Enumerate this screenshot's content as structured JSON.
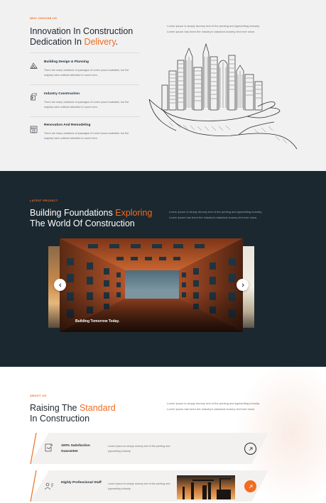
{
  "why": {
    "eyebrow": "WHY CHOOSE US",
    "title_line1": "Innovation In Construction",
    "title_line2_pre": "Dedication In ",
    "title_line2_accent": "Delivery",
    "title_line2_post": ".",
    "intro": "Lorem Ipsum is simply dummy text of the printing and typesetting industry. Lorem Ipsum has been the industry's standard dummy text ever since.",
    "features": [
      {
        "icon": "blueprint-icon",
        "title": "Building Design & Planning",
        "desc": "There are many variations of passages of Lorem Ipsum available, but the majority have suffered alteration in some form."
      },
      {
        "icon": "crane-building-icon",
        "title": "Industry Construction",
        "desc": "There are many variations of passages of Lorem Ipsum available, but the majority have suffered alteration in some form."
      },
      {
        "icon": "remodel-icon",
        "title": "Renovation And Remodeling",
        "desc": "There are many variations of passages of Lorem Ipsum available, but the majority have suffered alteration in some form."
      }
    ]
  },
  "project": {
    "eyebrow": "LATEST PROJECT",
    "title_pre": "Building Foundations ",
    "title_accent": "Exploring",
    "title_line2": "The World Of Construction",
    "intro": "Lorem Ipsum is simply dummy text of the printing and typesetting industry. Lorem Ipsum has been the industry's standard dummy text ever since.",
    "slide_caption": "Building Tomorrow Today.",
    "prev_icon": "chevron-left-icon",
    "next_icon": "chevron-right-icon"
  },
  "about": {
    "eyebrow": "ABOUT US",
    "title_pre": "Raising The ",
    "title_accent": "Standard",
    "title_line2": "In Construction",
    "intro": "Lorem Ipsum is simply dummy text of the printing and typesetting industry. Lorem Ipsum has been the industry's standard dummy text ever since.",
    "cards": [
      {
        "icon": "signature-icon",
        "title": "100% Satisfaction Guarantee",
        "desc": "Lorem Ipsum is simply dummy text of the printing and typesetting industry.",
        "arrow": "arrow-up-right-icon"
      },
      {
        "icon": "team-icon",
        "title": "Highly Professional Staff",
        "desc": "Lorem Ipsum is simply dummy text of the printing and typesetting industry.",
        "arrow": "arrow-up-right-icon"
      }
    ]
  },
  "colors": {
    "accent": "#f26b21",
    "dark": "#1b2830",
    "light_bg": "#f1f1f1"
  }
}
